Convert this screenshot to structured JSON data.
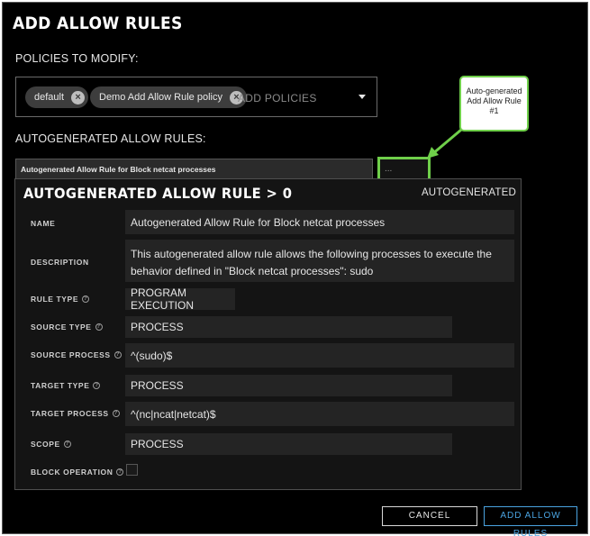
{
  "dialog": {
    "title": "ADD ALLOW RULES"
  },
  "policies": {
    "label": "POLICIES TO MODIFY:",
    "chips": [
      {
        "label": "default"
      },
      {
        "label": "Demo Add Allow Rule policy"
      }
    ],
    "placeholder": "ADD POLICIES"
  },
  "autogen": {
    "label": "AUTOGENERATED ALLOW RULES:",
    "row_label": "Autogenerated Allow Rule for Block netcat processes",
    "more_label": "..."
  },
  "callout": {
    "lines": [
      "Auto-generated",
      "Add Allow Rule",
      "#1"
    ]
  },
  "panel": {
    "title": "AUTOGENERATED ALLOW RULE > 0",
    "badge": "AUTOGENERATED",
    "fields": {
      "name": {
        "label": "NAME",
        "value": "Autogenerated Allow Rule for Block netcat processes"
      },
      "description": {
        "label": "DESCRIPTION",
        "value": "This autogenerated allow rule allows the following processes to execute the behavior defined in \"Block netcat processes\": sudo"
      },
      "rule_type": {
        "label": "RULE TYPE",
        "value": "PROGRAM EXECUTION"
      },
      "source_type": {
        "label": "SOURCE TYPE",
        "value": "PROCESS"
      },
      "source_process": {
        "label": "SOURCE PROCESS",
        "value": "^(sudo)$"
      },
      "target_type": {
        "label": "TARGET TYPE",
        "value": "PROCESS"
      },
      "target_process": {
        "label": "TARGET PROCESS",
        "value": "^(nc|ncat|netcat)$"
      },
      "scope": {
        "label": "SCOPE",
        "value": "PROCESS"
      },
      "block_operation": {
        "label": "BLOCK OPERATION",
        "checked": false
      }
    }
  },
  "buttons": {
    "cancel": "CANCEL",
    "add": "ADD ALLOW RULES"
  },
  "colors": {
    "accent_green": "#6fcf4a",
    "accent_blue": "#4aa3e0",
    "background": "#000000"
  },
  "icons": {
    "help": "help-circle-icon",
    "remove": "close-circle-icon",
    "dropdown": "chevron-down-icon"
  }
}
